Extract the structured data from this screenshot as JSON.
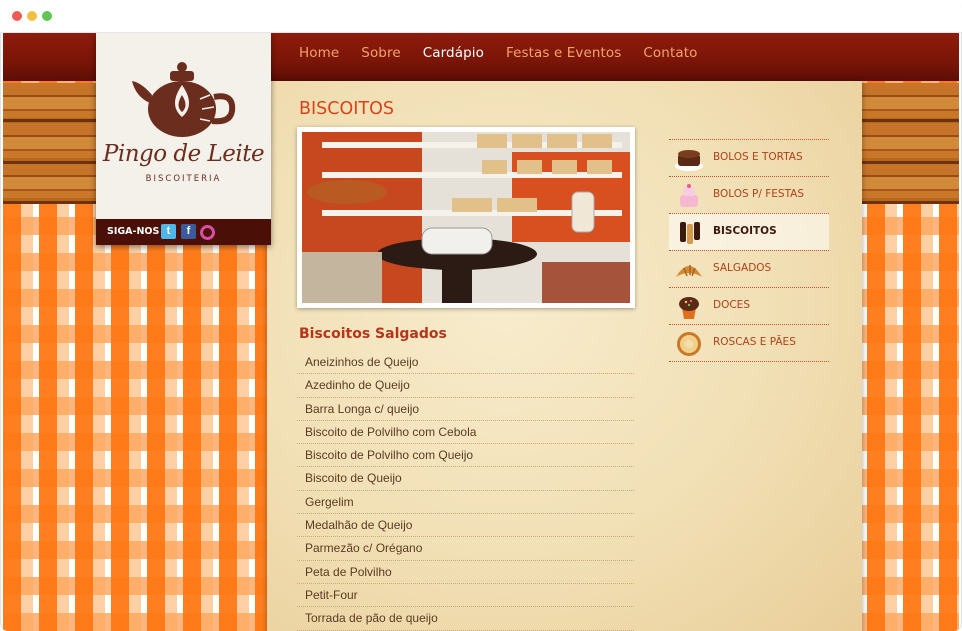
{
  "window": {
    "controls": [
      "close",
      "minimize",
      "maximize"
    ]
  },
  "brand": {
    "name": "Pingo de Leite",
    "tagline": "BISCOITERIA",
    "logo_icon": "teapot-icon",
    "follow_label": "SIGA-NOS",
    "social": [
      "twitter-icon",
      "facebook-icon",
      "instagram-icon"
    ]
  },
  "nav": {
    "items": [
      {
        "label": "Home",
        "active": false
      },
      {
        "label": "Sobre",
        "active": false
      },
      {
        "label": "Cardápio",
        "active": true
      },
      {
        "label": "Festas e Eventos",
        "active": false
      },
      {
        "label": "Contato",
        "active": false
      }
    ]
  },
  "page": {
    "heading": "BISCOITOS",
    "photo_alt": "bakery-shelves-photo"
  },
  "section": {
    "title": "Biscoitos Salgados",
    "items": [
      "Aneizinhos de Queijo",
      "Azedinho de Queijo",
      "Barra Longa c/ queijo",
      "Biscoito de Polvilho com Cebola",
      "Biscoito de Polvilho com Queijo",
      "Biscoito de Queijo",
      "Gergelim",
      "Medalhão de Queijo",
      "Parmezão c/ Orégano",
      "Peta de Polvilho",
      "Petit-Four",
      "Torrada de pão de queijo"
    ]
  },
  "categories": [
    {
      "label": "BOLOS E TORTAS",
      "icon": "cake-icon",
      "active": false
    },
    {
      "label": "BOLOS P/ FESTAS",
      "icon": "party-cake-icon",
      "active": false
    },
    {
      "label": "BISCOITOS",
      "icon": "biscuit-icon",
      "active": true
    },
    {
      "label": "SALGADOS",
      "icon": "croissant-icon",
      "active": false
    },
    {
      "label": "DOCES",
      "icon": "cupcake-icon",
      "active": false
    },
    {
      "label": "ROSCAS E PÃES",
      "icon": "donut-icon",
      "active": false
    }
  ],
  "colors": {
    "nav_bg": "#7a1508",
    "nav_text": "#f3a36a",
    "heading": "#d9431a",
    "section_title": "#b6361a",
    "checker_orange": "#ff7814"
  }
}
